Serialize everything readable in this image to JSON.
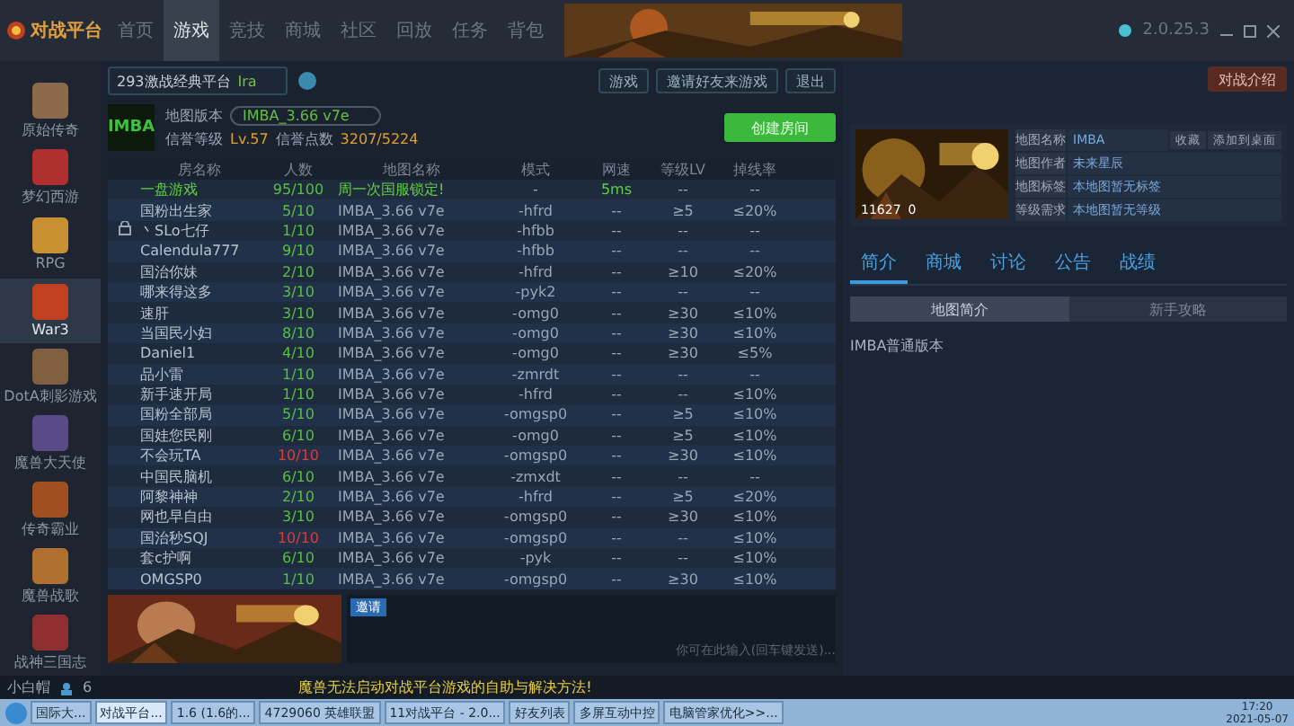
{
  "app": {
    "logo_text": "对战平台",
    "version": "2.0.25.3",
    "nav": [
      {
        "label": "首页",
        "selected": false
      },
      {
        "label": "游戏",
        "selected": true
      },
      {
        "label": "竞技",
        "selected": false
      },
      {
        "label": "商城",
        "selected": false
      },
      {
        "label": "社区",
        "selected": false
      },
      {
        "label": "回放",
        "selected": false
      },
      {
        "label": "任务",
        "selected": false
      },
      {
        "label": "背包",
        "selected": false
      }
    ]
  },
  "sidebar": {
    "items": [
      {
        "label": "原始传奇",
        "selected": false,
        "color": "#8a6a4a"
      },
      {
        "label": "梦幻西游",
        "selected": false,
        "color": "#b03030"
      },
      {
        "label": "RPG",
        "selected": false,
        "color": "#c89030"
      },
      {
        "label": "War3",
        "selected": true,
        "color": "#c04020"
      },
      {
        "label": "DotA刺影游戏",
        "selected": false,
        "color": "#806040"
      },
      {
        "label": "魔兽大天使",
        "selected": false,
        "color": "#5a4a8a"
      },
      {
        "label": "传奇霸业",
        "selected": false,
        "color": "#a05020"
      },
      {
        "label": "魔兽战歌",
        "selected": false,
        "color": "#b07030"
      },
      {
        "label": "战神三国志",
        "selected": false,
        "color": "#903030"
      }
    ]
  },
  "room_bar": {
    "room": "293激战经典平台",
    "tag": "Ira"
  },
  "toolbar_buttons": [
    "游戏",
    "邀请好友来游戏",
    "退出"
  ],
  "guild_button": "对战介绍",
  "map_info": {
    "logo": "IMBA",
    "version_label": "地图版本",
    "version": "IMBA_3.66 v7e",
    "level_label": "信誉等级",
    "level": "Lv.57",
    "points_label": "信誉点数",
    "points": "3207/5224"
  },
  "create_button": "创建房间",
  "table": {
    "columns": [
      "房名称",
      "人数",
      "地图名称",
      "模式",
      "网速",
      "等级LV",
      "掉线率"
    ],
    "rows": [
      {
        "kind": "promo",
        "locked": false,
        "full": false,
        "cells": [
          "一盘游戏",
          "95/100",
          "周一次国服锁定!",
          "-",
          "5ms",
          "--",
          "--"
        ]
      },
      {
        "kind": "normal",
        "locked": false,
        "full": false,
        "cells": [
          "国粉出生家",
          "5/10",
          "IMBA_3.66 v7e",
          "-hfrd",
          "--",
          "≥5",
          "≤20%"
        ]
      },
      {
        "kind": "normal",
        "locked": true,
        "full": false,
        "cells": [
          "丶SLo七仔",
          "1/10",
          "IMBA_3.66 v7e",
          "-hfbb",
          "--",
          "--",
          "--"
        ]
      },
      {
        "kind": "normal",
        "locked": false,
        "full": false,
        "cells": [
          "Calendula777",
          "9/10",
          "IMBA_3.66 v7e",
          "-hfbb",
          "--",
          "--",
          "--"
        ]
      },
      {
        "kind": "normal",
        "locked": false,
        "full": false,
        "cells": [
          "国治你妹",
          "2/10",
          "IMBA_3.66 v7e",
          "-hfrd",
          "--",
          "≥10",
          "≤20%"
        ]
      },
      {
        "kind": "normal",
        "locked": false,
        "full": false,
        "cells": [
          "哪来得这多",
          "3/10",
          "IMBA_3.66 v7e",
          "-pyk2",
          "--",
          "--",
          "--"
        ]
      },
      {
        "kind": "normal",
        "locked": false,
        "full": false,
        "cells": [
          "速肝",
          "3/10",
          "IMBA_3.66 v7e",
          "-omg0",
          "--",
          "≥30",
          "≤10%"
        ]
      },
      {
        "kind": "normal",
        "locked": false,
        "full": false,
        "cells": [
          "当国民小妇",
          "8/10",
          "IMBA_3.66 v7e",
          "-omg0",
          "--",
          "≥30",
          "≤10%"
        ]
      },
      {
        "kind": "normal",
        "locked": false,
        "full": false,
        "cells": [
          "Daniel1",
          "4/10",
          "IMBA_3.66 v7e",
          "-omg0",
          "--",
          "≥30",
          "≤5%"
        ]
      },
      {
        "kind": "normal",
        "locked": false,
        "full": false,
        "cells": [
          "品小雷",
          "1/10",
          "IMBA_3.66 v7e",
          "-zmrdt",
          "--",
          "--",
          "--"
        ]
      },
      {
        "kind": "normal",
        "locked": false,
        "full": false,
        "cells": [
          "新手速开局",
          "1/10",
          "IMBA_3.66 v7e",
          "-hfrd",
          "--",
          "--",
          "≤10%"
        ]
      },
      {
        "kind": "normal",
        "locked": false,
        "full": false,
        "cells": [
          "国粉全部局",
          "5/10",
          "IMBA_3.66 v7e",
          "-omgsp0",
          "--",
          "≥5",
          "≤10%"
        ]
      },
      {
        "kind": "normal",
        "locked": false,
        "full": false,
        "cells": [
          "国娃您民刚",
          "6/10",
          "IMBA_3.66 v7e",
          "-omg0",
          "--",
          "≥5",
          "≤10%"
        ]
      },
      {
        "kind": "normal",
        "locked": false,
        "full": true,
        "cells": [
          "不会玩TA",
          "10/10",
          "IMBA_3.66 v7e",
          "-omgsp0",
          "--",
          "≥30",
          "≤10%"
        ]
      },
      {
        "kind": "normal",
        "locked": false,
        "full": false,
        "cells": [
          "中国民脑机",
          "6/10",
          "IMBA_3.66 v7e",
          "-zmxdt",
          "--",
          "--",
          "--"
        ]
      },
      {
        "kind": "normal",
        "locked": false,
        "full": false,
        "cells": [
          "阿黎神神",
          "2/10",
          "IMBA_3.66 v7e",
          "-hfrd",
          "--",
          "≥5",
          "≤20%"
        ]
      },
      {
        "kind": "normal",
        "locked": false,
        "full": false,
        "cells": [
          "网也早自由",
          "3/10",
          "IMBA_3.66 v7e",
          "-omgsp0",
          "--",
          "≥30",
          "≤10%"
        ]
      },
      {
        "kind": "normal",
        "locked": false,
        "full": true,
        "cells": [
          "国治秒SQJ",
          "10/10",
          "IMBA_3.66 v7e",
          "-omgsp0",
          "--",
          "--",
          "≤10%"
        ]
      },
      {
        "kind": "normal",
        "locked": false,
        "full": false,
        "cells": [
          "套c护啊",
          "6/10",
          "IMBA_3.66 v7e",
          "-pyk",
          "--",
          "--",
          "≤10%"
        ]
      },
      {
        "kind": "normal",
        "locked": false,
        "full": false,
        "cells": [
          "OMGSP0",
          "1/10",
          "IMBA_3.66 v7e",
          "-omgsp0",
          "--",
          "≥30",
          "≤10%"
        ]
      }
    ]
  },
  "chat": {
    "tag": "邀请",
    "placeholder": "你可在此输入(回车键发送)..."
  },
  "map_card": {
    "likes": "11627",
    "hearts": "0",
    "actions": [
      "收藏",
      "添加到桌面"
    ],
    "details": [
      {
        "label": "地图名称",
        "value": "IMBA"
      },
      {
        "label": "地图作者",
        "value": "未来星辰"
      },
      {
        "label": "地图标签",
        "value": "本地图暂无标签"
      },
      {
        "label": "等级需求",
        "value": "本地图暂无等级"
      }
    ]
  },
  "detail_tabs": [
    {
      "label": "简介",
      "selected": true
    },
    {
      "label": "商城",
      "selected": false
    },
    {
      "label": "讨论",
      "selected": false
    },
    {
      "label": "公告",
      "selected": false
    },
    {
      "label": "战绩",
      "selected": false
    }
  ],
  "sub_tabs": [
    {
      "label": "地图简介",
      "selected": true
    },
    {
      "label": "新手攻略",
      "selected": false
    }
  ],
  "description": "IMBA普通版本",
  "status_bar": {
    "user": "小白帽",
    "friends": "6",
    "notice": "魔兽无法启动对战平台游戏的自助与解决方法!"
  },
  "taskbar": {
    "time": "17:20",
    "date": "2021-05-07",
    "items": [
      {
        "label": "国际大...",
        "selected": false
      },
      {
        "label": "对战平台...",
        "selected": true
      },
      {
        "label": "1.6 (1.6的...",
        "selected": false
      },
      {
        "label": "4729060 英雄联盟",
        "selected": false
      },
      {
        "label": "11对战平台 - 2.0...",
        "selected": false
      },
      {
        "label": "好友列表",
        "selected": false
      },
      {
        "label": "多屏互动中控",
        "selected": false
      },
      {
        "label": "电脑管家优化>>...",
        "selected": false
      }
    ]
  }
}
